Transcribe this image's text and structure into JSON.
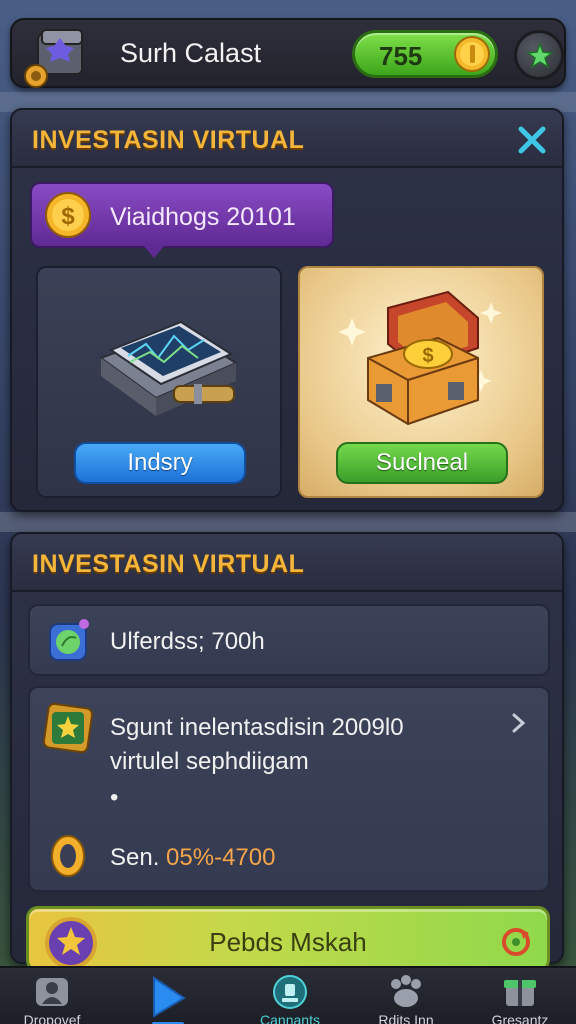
{
  "header": {
    "player_name": "Surh Calast",
    "coins": "755"
  },
  "panel1": {
    "title": "INVESTASIN VIRTUAL",
    "balloon_text": "Viaidhogs 20101",
    "card_left_button": "Indsry",
    "card_right_button": "Suclneal"
  },
  "panel2": {
    "title": "INVESTASIN VIRTUAL",
    "row1_text": "Ulferdss; 700h",
    "row2_line1": "Sgunt inelentasdisin 2009l0",
    "row2_line2": "virtulel sephdiigam",
    "row2_bullet": "•",
    "row3_prefix": "Sen.",
    "row3_rate": "05%-4700",
    "cta_label": "Pebds Mskah"
  },
  "nav": [
    {
      "label": "Dropovef",
      "icon": "person-icon"
    },
    {
      "label": "",
      "icon": "play-arrow-icon"
    },
    {
      "label": "Cannants",
      "icon": "trophy-icon"
    },
    {
      "label": "Rdits Inn",
      "icon": "paw-icon"
    },
    {
      "label": "Gresantz",
      "icon": "gift-icon"
    }
  ],
  "colors": {
    "accent_title": "#f3b53a",
    "coin_pill": "#3ea51b",
    "balloon": "#6b2fa3",
    "active_nav": "#4fd1d8"
  }
}
